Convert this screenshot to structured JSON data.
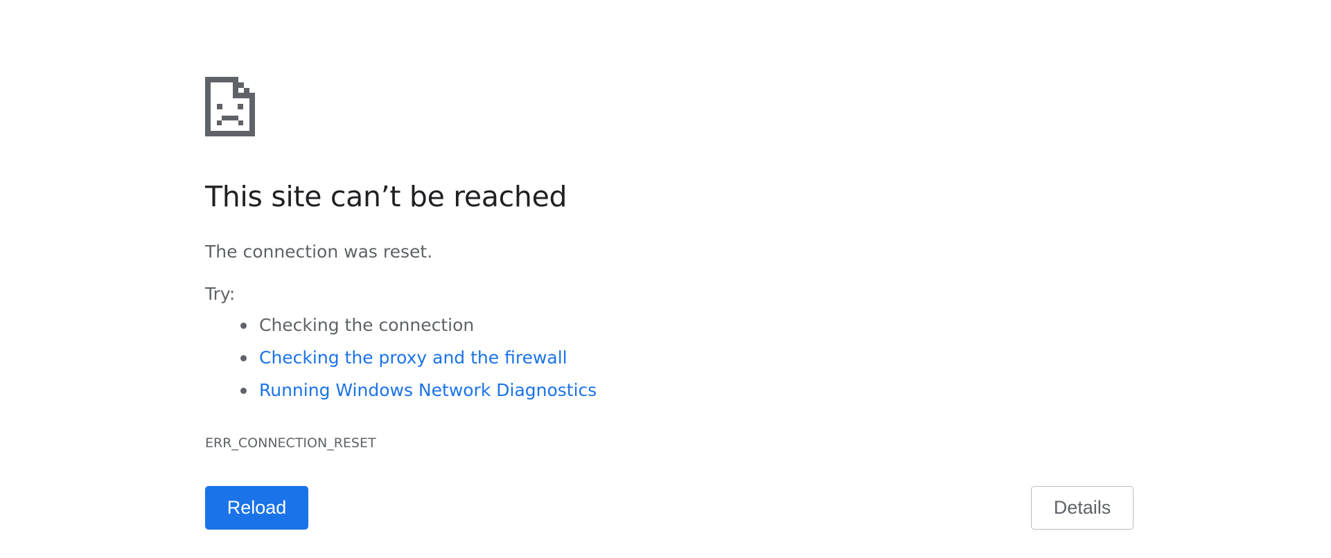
{
  "error_page": {
    "icon": "sad-page-icon",
    "headline": "This site can’t be reached",
    "message": "The connection was reset.",
    "try_label": "Try:",
    "suggestions": [
      {
        "text": "Checking the connection",
        "is_link": false
      },
      {
        "text": "Checking the proxy and the firewall",
        "is_link": true
      },
      {
        "text": "Running Windows Network Diagnostics",
        "is_link": true
      }
    ],
    "error_code": "ERR_CONNECTION_RESET",
    "reload_label": "Reload",
    "details_label": "Details"
  },
  "colors": {
    "headline": "#202124",
    "body_text": "#5f6368",
    "link": "#1a73e8",
    "primary_button": "#1a73e8",
    "icon": "#5f6368"
  }
}
